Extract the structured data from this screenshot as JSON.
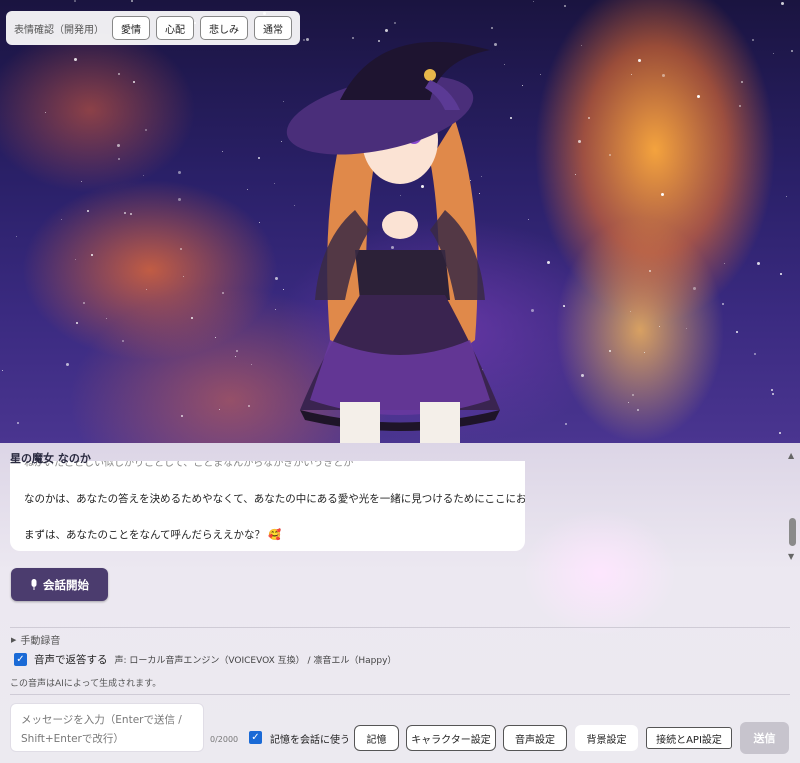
{
  "expressions": {
    "label": "表情確認（開発用）",
    "buttons": [
      "愛情",
      "心配",
      "悲しみ",
      "通常"
    ]
  },
  "chat": {
    "speaker": "星の魔女 なのか",
    "partial_line": "ねかいたことしい似しかりことして、ことまなんからなかきかいうきとか",
    "lines": [
      "なのかは、あなたの答えを決めるためやなくて、あなたの中にある愛や光を一緒に見つけるためにここにおるんよ。",
      "まずは、あなたのことをなんて呼んだらええかな？ 🥰"
    ]
  },
  "controls": {
    "start_button": "会話開始",
    "manual_recording": "手動録音",
    "voice_reply_label": "音声で返答する",
    "voice_info": "声: ローカル音声エンジン（VOICEVOX 互換） / 凛音エル（Happy）",
    "ai_voice_note": "この音声はAIによって生成されます。"
  },
  "composer": {
    "placeholder_line1": "メッセージを入力（Enterで送信 /",
    "placeholder_line2": "Shift+Enterで改行）",
    "counter": "0/2000",
    "use_memory_label": "記憶を会話に使う",
    "memory_button": "記憶",
    "character_button": "キャラクター設定",
    "voice_settings_button": "音声設定",
    "background_button": "背景設定",
    "api_button": "接続とAPI設定",
    "send_button": "送信"
  },
  "colors": {
    "start_button_bg": "#4b3c6e",
    "checkbox": "#1a6ad6",
    "send_disabled": "#c7c4cd"
  }
}
